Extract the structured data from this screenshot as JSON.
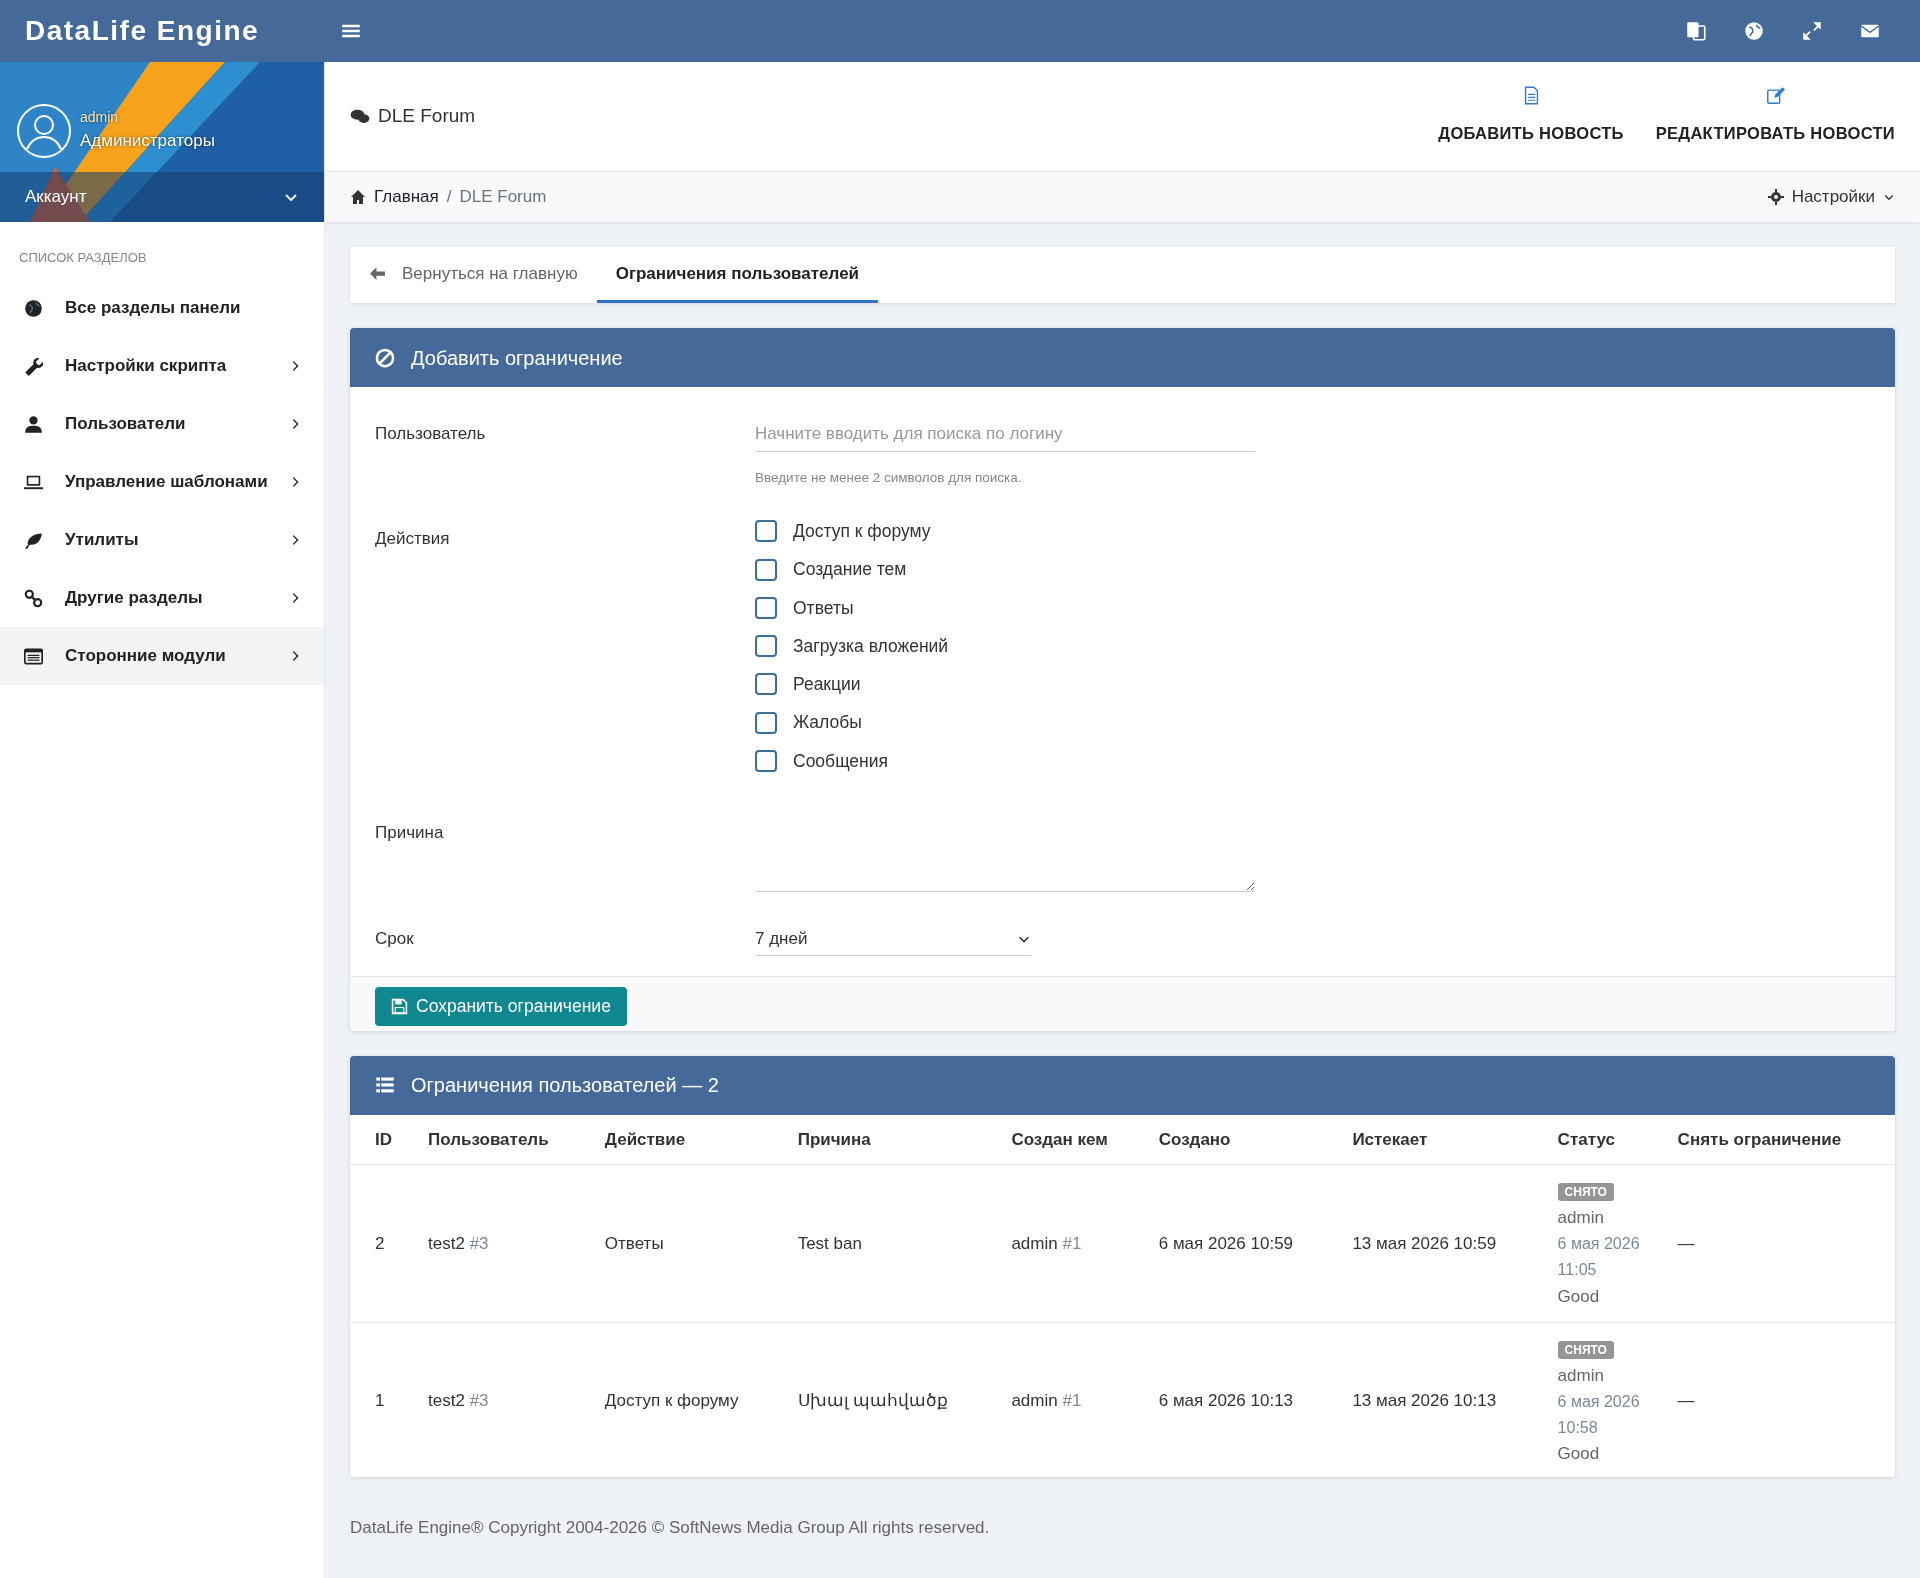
{
  "brand": "DataLife Engine",
  "user": {
    "name": "admin",
    "group": "Администраторы",
    "menu_label": "Аккаунт"
  },
  "sidebar": {
    "heading": "СПИСОК РАЗДЕЛОВ",
    "items": [
      {
        "label": "Все разделы панели",
        "has_submenu": false,
        "selected": false
      },
      {
        "label": "Настройки скрипта",
        "has_submenu": true,
        "selected": false
      },
      {
        "label": "Пользователи",
        "has_submenu": true,
        "selected": false
      },
      {
        "label": "Управление шаблонами",
        "has_submenu": true,
        "selected": false
      },
      {
        "label": "Утилиты",
        "has_submenu": true,
        "selected": false
      },
      {
        "label": "Другие разделы",
        "has_submenu": true,
        "selected": false
      },
      {
        "label": "Сторонние модули",
        "has_submenu": true,
        "selected": true
      }
    ]
  },
  "page_header": {
    "title": "DLE Forum",
    "actions": [
      {
        "label": "ДОБАВИТЬ НОВОСТЬ"
      },
      {
        "label": "РЕДАКТИРОВАТЬ НОВОСТИ"
      }
    ]
  },
  "breadcrumb": {
    "separator": "/",
    "items": [
      {
        "label": "Главная",
        "current": false
      },
      {
        "label": "DLE Forum",
        "current": true
      }
    ]
  },
  "settings_menu": "Настройки",
  "tabs": [
    {
      "label": "Вернуться на главную",
      "selected": false
    },
    {
      "label": "Ограничения пользователей",
      "selected": true
    }
  ],
  "form": {
    "title": "Добавить ограничение",
    "user": {
      "label": "Пользователь",
      "placeholder": "Начните вводить для поиска по логину",
      "hint": "Введите не менее 2 символов для поиска."
    },
    "actions": {
      "label": "Действия",
      "options": [
        {
          "label": "Доступ к форуму",
          "checked": false
        },
        {
          "label": "Создание тем",
          "checked": false
        },
        {
          "label": "Ответы",
          "checked": false
        },
        {
          "label": "Загрузка вложений",
          "checked": false
        },
        {
          "label": "Реакции",
          "checked": false
        },
        {
          "label": "Жалобы",
          "checked": false
        },
        {
          "label": "Сообщения",
          "checked": false
        }
      ]
    },
    "reason": {
      "label": "Причина"
    },
    "term": {
      "label": "Срок",
      "value": "7 дней"
    },
    "save_button": "Сохранить ограничение"
  },
  "restrictions": {
    "title": "Ограничения пользователей — 2",
    "columns": [
      "ID",
      "Пользователь",
      "Действие",
      "Причина",
      "Создан кем",
      "Создано",
      "Истекает",
      "Статус",
      "Снять ограничение"
    ],
    "rows": [
      {
        "id": "2",
        "user": "test2",
        "user_id": "#3",
        "action": "Ответы",
        "reason": "Test ban",
        "created_by": "admin",
        "created_by_id": "#1",
        "created": "6 мая 2026 10:59",
        "expires": "13 мая 2026 10:59",
        "status": {
          "badge": "СНЯТО",
          "by": "admin",
          "date": "6 мая 2026 11:05",
          "note": "Good"
        },
        "remove": "—"
      },
      {
        "id": "1",
        "user": "test2",
        "user_id": "#3",
        "action": "Доступ к форуму",
        "reason": "Սխալ պահվածք",
        "created_by": "admin",
        "created_by_id": "#1",
        "created": "6 мая 2026 10:13",
        "expires": "13 мая 2026 10:13",
        "status": {
          "badge": "СНЯТО",
          "by": "admin",
          "date": "6 мая 2026 10:58",
          "note": "Good"
        },
        "remove": "—"
      }
    ]
  },
  "footer": {
    "text": "DataLife Engine® Copyright 2004-2026 ©",
    "link": "SoftNews Media Group",
    "suffix": "All rights reserved."
  }
}
